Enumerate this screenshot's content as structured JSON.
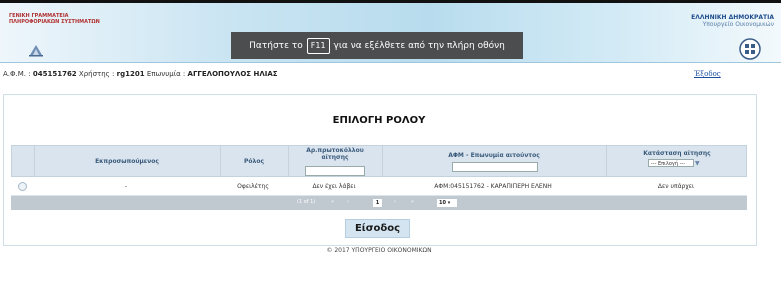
{
  "banner": {
    "left_logo_lines": [
      "ΓΕΝΙΚΗ ΓΡΑΜΜΑΤΕΙΑ",
      "ΠΛΗΡΟΦΟΡΙΑΚΩΝ ΣΥΣΤΗΜΑΤΩΝ"
    ],
    "right_title": "ΕΛΛΗΝΙΚΗ ΔΗΜΟΚΡΑΤΙΑ",
    "right_subtitle": "Υπουργείο Οικονομικών",
    "left_logo_icon": "gsis-logo-icon",
    "right_logo_icon": "greek-emblem-icon"
  },
  "toast": {
    "before": "Πατήστε το",
    "key": "F11",
    "after": "για να εξέλθετε από την πλήρη οθόνη"
  },
  "userbar": {
    "afm_label": "Α.Φ.Μ. :",
    "afm_value": "045151762",
    "user_label": "Χρήστης :",
    "user_value": "rg1201",
    "surname_label": "Επωνυμία :",
    "surname_value": "ΑΓΓΕΛΟΠΟΥΛΟΣ ΗΛΙΑΣ",
    "exit_link": "Έξοδος"
  },
  "page": {
    "title": "ΕΠΙΛΟΓΗ ΡΟΛΟΥ",
    "enter_button": "Είσοδος",
    "footer": "© 2017 ΥΠΟΥΡΓΕΙΟ ΟΙΚΟΝΟΜΙΚΩΝ"
  },
  "table": {
    "headers": {
      "represented": "Εκπροσωπούμενος",
      "role": "Ρόλος",
      "protocol_line1": "Αρ.πρωτοκόλλου",
      "protocol_line2": "αίτησης",
      "afm": "ΑΦΜ - Επωνυμία αιτούντος",
      "status_line1": "Κατάσταση αίτησης",
      "status_line2": "--- Επιλογή ---"
    },
    "rows": [
      {
        "represented": "-",
        "role": "Οφειλέτης",
        "protocol": "Δεν έχει λάβει",
        "afm": "ΑΦΜ:045151762 - ΚΑΡΑΠΙΠΕΡΗ ΕΛΕΝΗ",
        "status": "Δεν υπάρχει"
      }
    ],
    "pager": {
      "info": "(1 of 1)",
      "first": "«",
      "prev": "‹",
      "current": "1",
      "next": "›",
      "last": "»",
      "page_size": "10 ▾"
    }
  },
  "colors": {
    "header_bg": "#d9e4ee",
    "pager_bg": "#c0c8d0",
    "button_bg": "#d4e5f1",
    "toast_bg": "#4b4d4f"
  }
}
